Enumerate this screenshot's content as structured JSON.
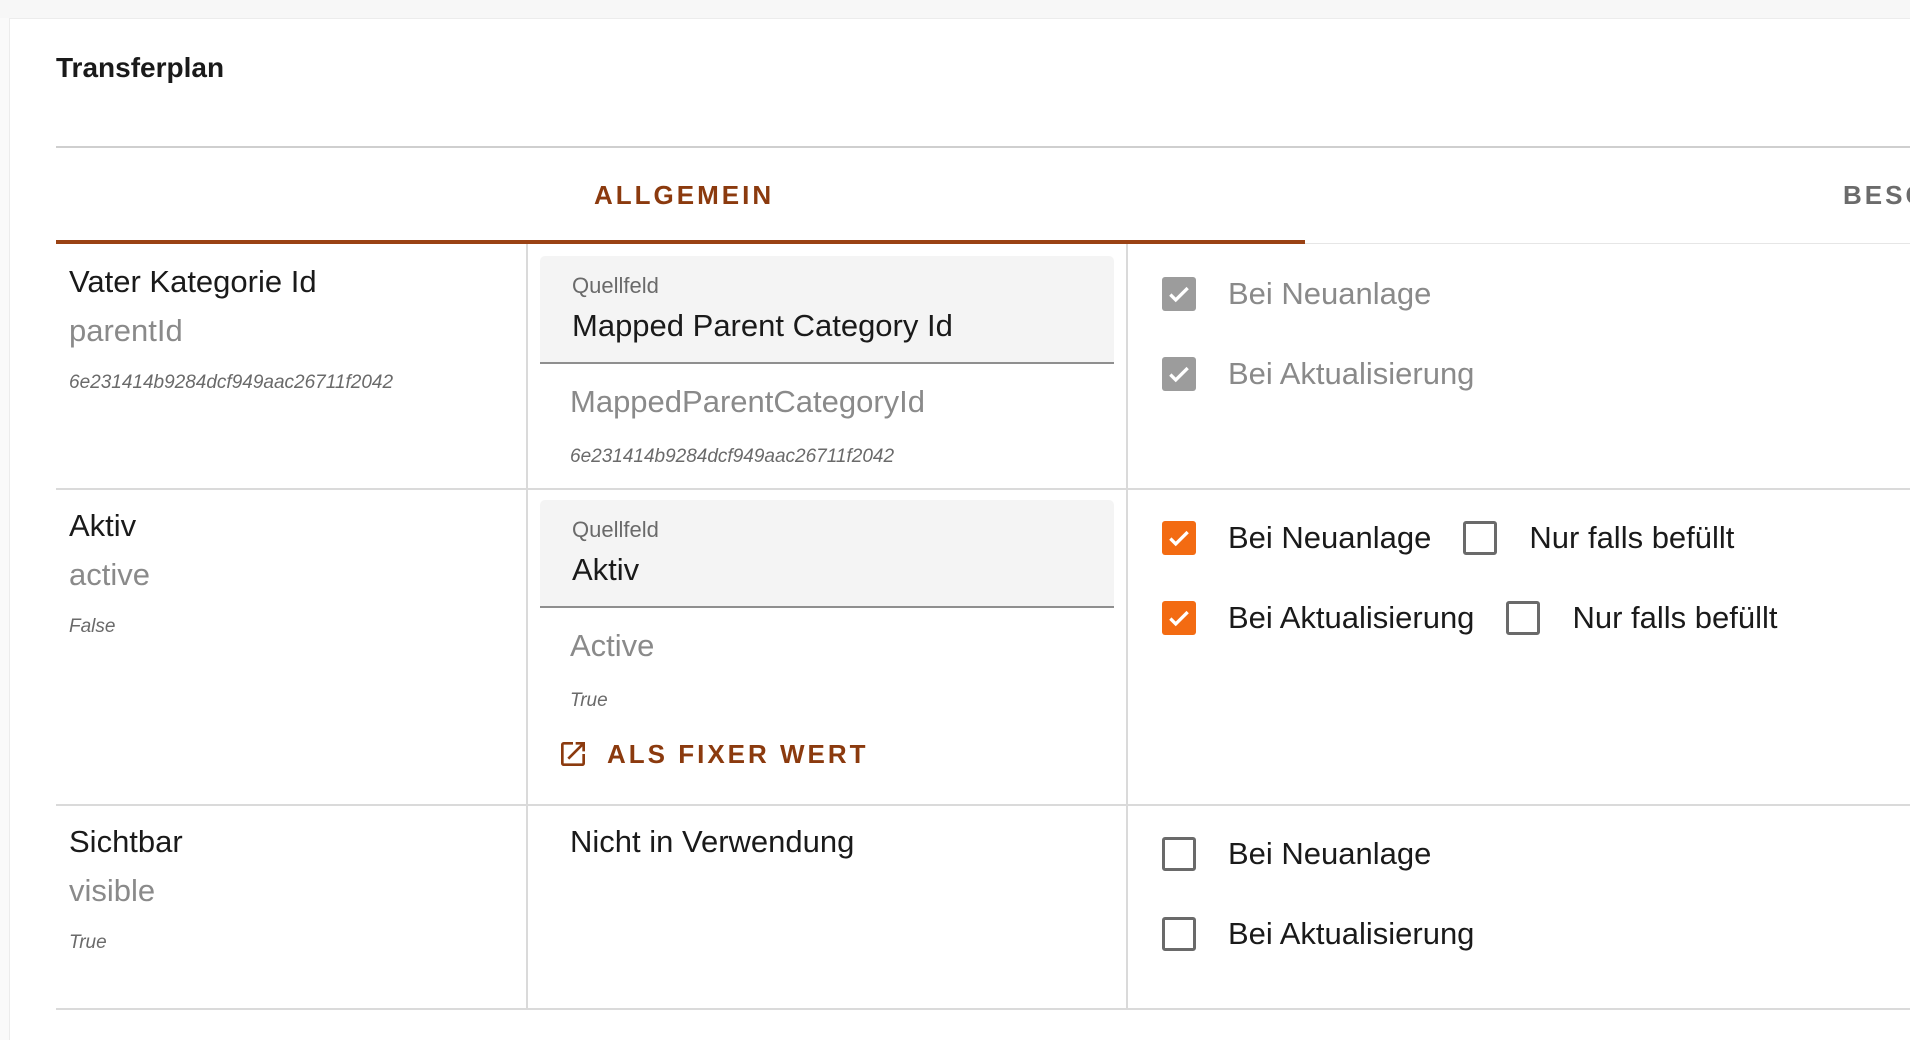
{
  "card": {
    "title": "Transferplan"
  },
  "tabs": [
    {
      "label": "ALLGEMEIN",
      "active": true
    },
    {
      "label": "BESC",
      "active": false
    }
  ],
  "colors": {
    "accent": "#9a4214",
    "checkbox_on": "#f36b12",
    "checkbox_disabled": "#9c9c9c"
  },
  "rows": [
    {
      "label": "Vater Kategorie Id",
      "key": "parentId",
      "id": "6e231414b9284dcf949aac26711f2042",
      "source": {
        "caption": "Quellfeld",
        "value": "Mapped Parent Category Id"
      },
      "target": {
        "name": "MappedParentCategoryId",
        "value": "6e231414b9284dcf949aac26711f2042"
      },
      "options": {
        "on_create": {
          "label": "Bei Neuanlage",
          "checked": true,
          "disabled": true
        },
        "on_update": {
          "label": "Bei Aktualisierung",
          "checked": true,
          "disabled": true
        }
      }
    },
    {
      "label": "Aktiv",
      "key": "active",
      "id": "False",
      "source": {
        "caption": "Quellfeld",
        "value": "Aktiv"
      },
      "target": {
        "name": "Active",
        "value": "True"
      },
      "fixed_value_button": "ALS FIXER WERT",
      "options": {
        "on_create": {
          "label": "Bei Neuanlage",
          "checked": true
        },
        "on_create_only_if_filled": {
          "label": "Nur falls befüllt",
          "checked": false
        },
        "on_update": {
          "label": "Bei Aktualisierung",
          "checked": true
        },
        "on_update_only_if_filled": {
          "label": "Nur falls befüllt",
          "checked": false
        }
      }
    },
    {
      "label": "Sichtbar",
      "key": "visible",
      "id": "True",
      "source": {
        "not_used_text": "Nicht in Verwendung"
      },
      "options": {
        "on_create": {
          "label": "Bei Neuanlage",
          "checked": false
        },
        "on_update": {
          "label": "Bei Aktualisierung",
          "checked": false
        }
      }
    }
  ]
}
